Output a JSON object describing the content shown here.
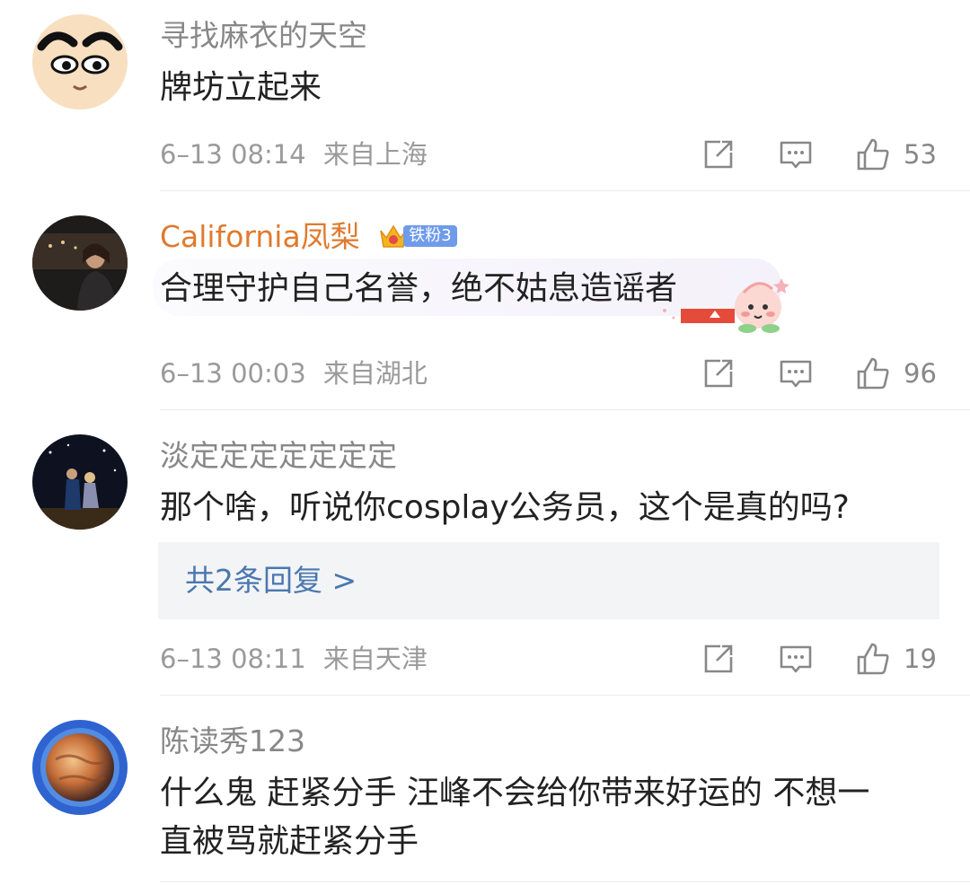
{
  "comments": [
    {
      "username": "寻找麻衣的天空",
      "text": "牌坊立起来",
      "time": "6–13 08:14",
      "location": "来自上海",
      "likes": "53",
      "avatar_icon": "cartoon-face-avatar"
    },
    {
      "username": "California凤梨",
      "badge": "铁粉3",
      "text": "合理守护自己名誉，绝不姑息造谣者",
      "time": "6–13 00:03",
      "location": "来自湖北",
      "likes": "96",
      "avatar_icon": "night-photo-avatar"
    },
    {
      "username": "淡定定定定定定定",
      "text": "那个啥，听说你cosplay公务员，这个是真的吗?",
      "reply_link": "共2条回复 >",
      "time": "6–13 08:11",
      "location": "来自天津",
      "likes": "19",
      "avatar_icon": "concert-photo-avatar"
    },
    {
      "username": "陈读秀123",
      "text_line1": "什么鬼 赶紧分手 汪峰不会给你带来好运的 不想一",
      "text_line2": "直被骂就赶紧分手",
      "avatar_icon": "planet-avatar"
    }
  ],
  "icons": {
    "share": "share-icon",
    "comment": "comment-icon",
    "like": "like-icon"
  },
  "colors": {
    "vip_name": "#e07a2e",
    "link": "#4a77b0",
    "meta": "#9a9a9a",
    "badge": "#6f9bea"
  }
}
